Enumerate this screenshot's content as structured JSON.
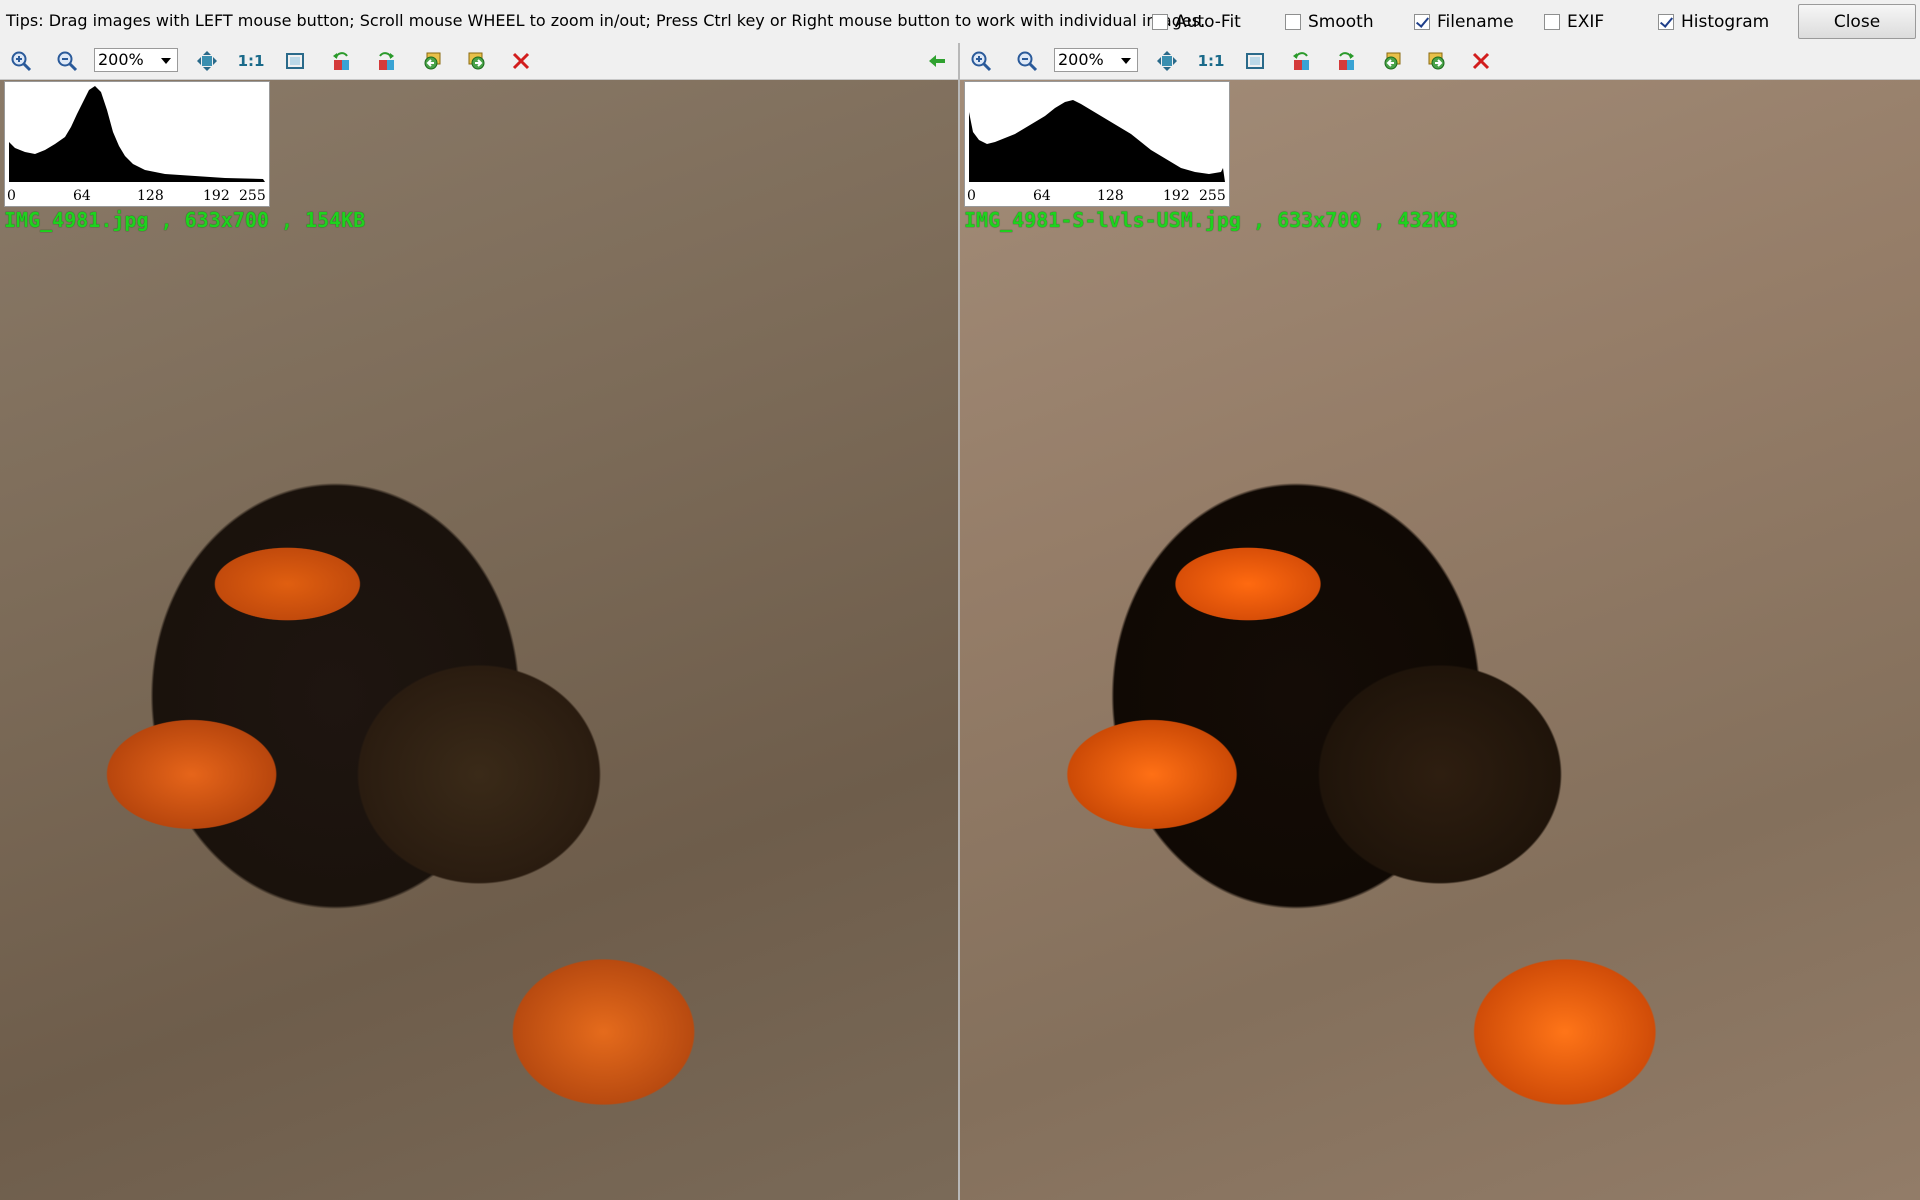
{
  "tips": "Tips: Drag images with LEFT mouse button; Scroll mouse WHEEL to zoom in/out; Press Ctrl key or Right mouse button to work with individual images.",
  "options": [
    {
      "label": "Auto-Fit",
      "checked": false
    },
    {
      "label": "Smooth",
      "checked": false
    },
    {
      "label": "Filename",
      "checked": true
    },
    {
      "label": "EXIF",
      "checked": false
    },
    {
      "label": "Histogram",
      "checked": true
    }
  ],
  "close_label": "Close",
  "panes": {
    "left": {
      "zoom": "200%",
      "one_to_one": "1:1",
      "histogram_ticks": [
        "0",
        "64",
        "128",
        "192",
        "255"
      ],
      "filename": "IMG_4981.jpg , 633x700 , 154KB"
    },
    "right": {
      "zoom": "200%",
      "one_to_one": "1:1",
      "histogram_ticks": [
        "0",
        "64",
        "128",
        "192",
        "255"
      ],
      "filename": "IMG_4981-S-lvls-USM.jpg , 633x700 , 432KB"
    }
  },
  "icons": [
    "zoom-in-icon",
    "zoom-out-icon",
    "fit-width-icon",
    "fit-window-icon",
    "rotate-left-icon",
    "rotate-right-icon",
    "prev-image-icon",
    "next-image-icon",
    "close-image-icon",
    "sync-arrow-icon"
  ],
  "colors": {
    "filename_text": "#1ed21e",
    "close_x": "#d21d1d",
    "sync_arrow": "#2fa12f"
  }
}
